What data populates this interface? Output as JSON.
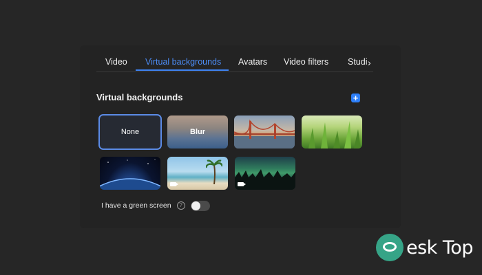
{
  "tabs": [
    {
      "label": "Video",
      "active": false
    },
    {
      "label": "Virtual backgrounds",
      "active": true
    },
    {
      "label": "Avatars",
      "active": false
    },
    {
      "label": "Video filters",
      "active": false
    },
    {
      "label": "Studio",
      "active": false
    }
  ],
  "section": {
    "title": "Virtual backgrounds",
    "add_icon": "plus-icon"
  },
  "backgrounds": [
    {
      "label": "None",
      "selected": true
    },
    {
      "label": "Blur",
      "selected": false
    },
    {
      "label": "",
      "image": "golden-gate-bridge"
    },
    {
      "label": "",
      "image": "grass"
    },
    {
      "label": "",
      "image": "earth-from-space"
    },
    {
      "label": "",
      "image": "beach-palm",
      "video": true
    },
    {
      "label": "",
      "image": "aurora",
      "video": true
    }
  ],
  "green_screen": {
    "label": "I have a green screen",
    "enabled": false,
    "help_icon": "question-icon"
  },
  "watermark": {
    "text": "esk Top"
  },
  "colors": {
    "accent": "#3f84f3",
    "background": "#262626",
    "panel": "#232323"
  }
}
